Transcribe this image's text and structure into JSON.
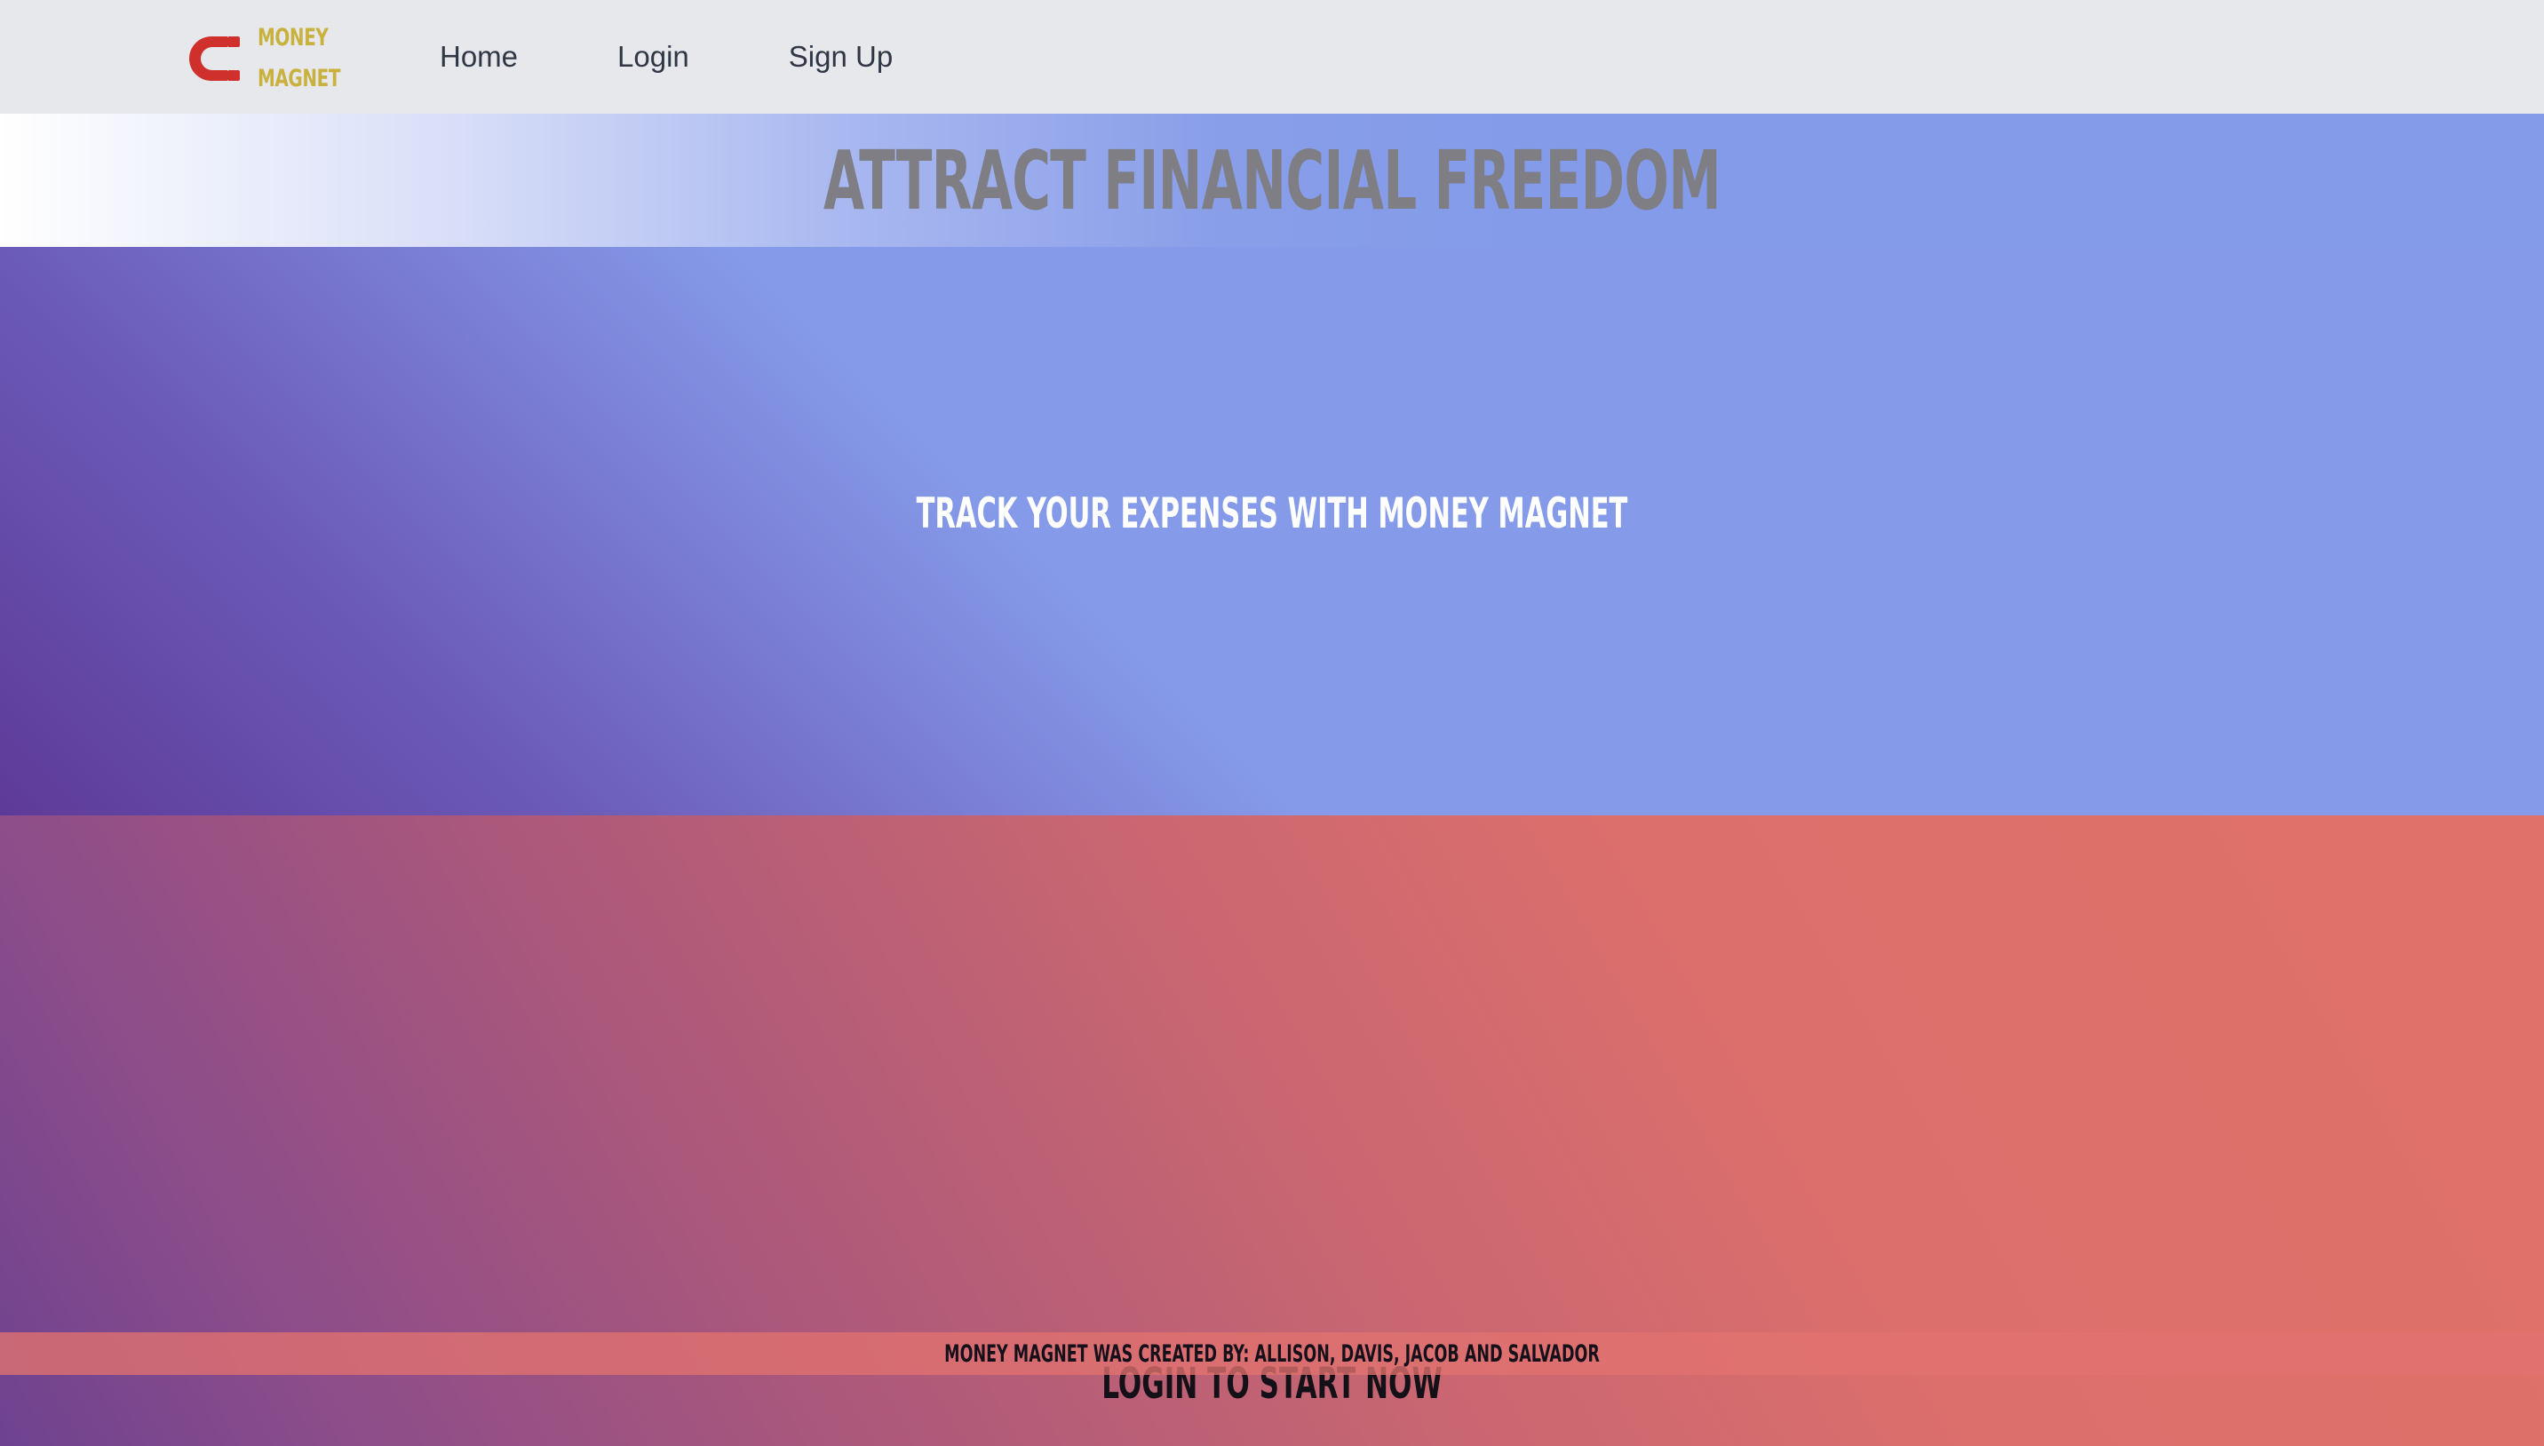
{
  "navbar": {
    "logo": {
      "icon": "magnet-icon",
      "line1": "MONEY",
      "line2": "MAGNET",
      "icon_color": "#d0302c",
      "text_color": "#c9b13d"
    },
    "links": [
      {
        "label": "Home"
      },
      {
        "label": "Login"
      },
      {
        "label": "Sign Up"
      }
    ]
  },
  "hero": {
    "title": "Attract Financial Freedom"
  },
  "feature": {
    "text": "Track your expenses with Money Magnet"
  },
  "cta": {
    "text": "Login to start now"
  },
  "footer": {
    "credits": "Money Magnet was created by: Allison, Davis, Jacob and Salvador"
  },
  "colors": {
    "navbar_bg": "#e7e8eb",
    "hero_blue": "#839be9",
    "feature_purple": "#5e3a98",
    "cta_coral": "#e07169",
    "footer_bg": "#e27270"
  }
}
